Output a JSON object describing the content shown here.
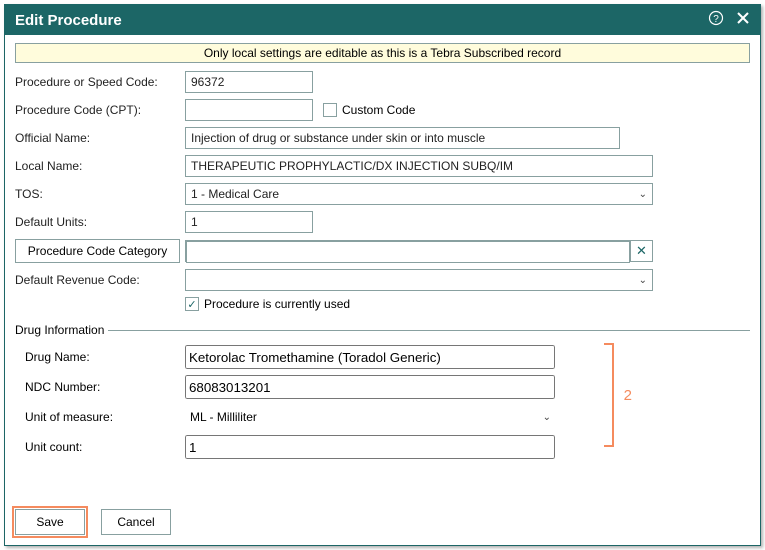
{
  "window": {
    "title": "Edit Procedure"
  },
  "notice": "Only local settings are editable as this is a Tebra Subscribed record",
  "labels": {
    "procedure_or_speed_code": "Procedure or Speed Code:",
    "procedure_code_cpt": "Procedure Code (CPT):",
    "custom_code": "Custom Code",
    "official_name": "Official Name:",
    "local_name": "Local Name:",
    "tos": "TOS:",
    "default_units": "Default Units:",
    "procedure_code_category": "Procedure Code Category",
    "default_revenue_code": "Default Revenue Code:",
    "procedure_currently_used": "Procedure is currently used",
    "drug_information": "Drug Information",
    "drug_name": "Drug Name:",
    "ndc_number": "NDC Number:",
    "unit_of_measure": "Unit of measure:",
    "unit_count": "Unit count:"
  },
  "values": {
    "procedure_or_speed_code": "96372",
    "procedure_code_cpt": "",
    "custom_code_checked": false,
    "official_name": "Injection of drug or substance under skin or into muscle",
    "local_name": "THERAPEUTIC PROPHYLACTIC/DX INJECTION SUBQ/IM",
    "tos": "1 - Medical Care",
    "default_units": "1",
    "procedure_code_category": "",
    "default_revenue_code": "",
    "procedure_currently_used_checked": true,
    "drug_name": "Ketorolac Tromethamine (Toradol Generic)",
    "ndc_number": "68083013201",
    "unit_of_measure": "ML - Milliliter",
    "unit_count": "1"
  },
  "callout": {
    "marker": "2"
  },
  "buttons": {
    "save": "Save",
    "cancel": "Cancel"
  }
}
